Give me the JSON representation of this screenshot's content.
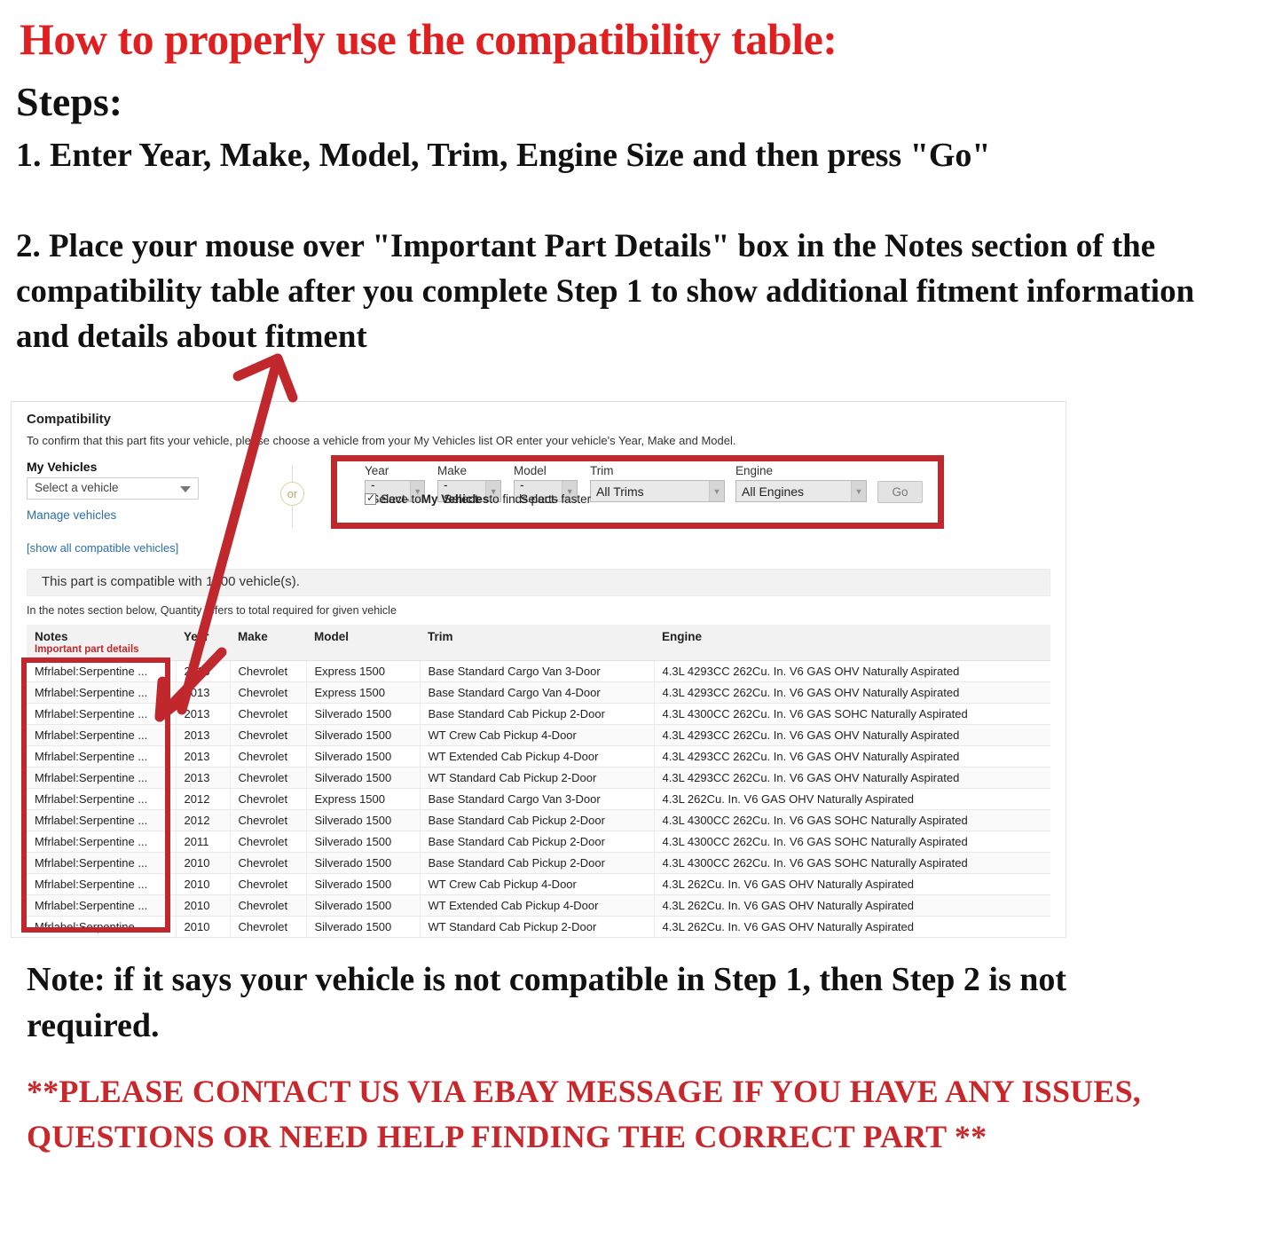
{
  "instructions": {
    "headline": "How to properly use the compatibility table:",
    "steps_label": "Steps:",
    "step1": "1. Enter Year, Make, Model, Trim, Engine Size and then press \"Go\"",
    "step2": "2. Place your mouse over \"Important Part Details\" box in the Notes section of the compatibility table after you complete Step 1 to show additional fitment information and details about fitment",
    "note": "Note: if it says your vehicle is not compatible in Step 1, then Step 2 is not required.",
    "contact": "**PLEASE CONTACT US VIA EBAY MESSAGE IF YOU HAVE ANY ISSUES, QUESTIONS OR NEED HELP FINDING THE CORRECT PART **"
  },
  "colors": {
    "headline_red": "#e02020",
    "annotation_red": "#c0282d",
    "contact_red": "#c8282c",
    "link_blue": "#2b6ea8"
  },
  "panel": {
    "title": "Compatibility",
    "subtitle": "To confirm that this part fits your vehicle, please choose a vehicle from your My Vehicles list OR enter your vehicle's Year, Make and Model.",
    "my_vehicles": {
      "label": "My Vehicles",
      "select_value": "Select a vehicle",
      "manage_link": "Manage vehicles",
      "show_all_link": "[show all compatible vehicles]"
    },
    "or_divider": "or",
    "finder": {
      "fields": [
        {
          "label": "Year",
          "value": "-Select-"
        },
        {
          "label": "Make",
          "value": "-Select-"
        },
        {
          "label": "Model",
          "value": "-Select-"
        },
        {
          "label": "Trim",
          "value": "All Trims"
        },
        {
          "label": "Engine",
          "value": "All Engines"
        }
      ],
      "go_label": "Go",
      "save_prefix": "Save to ",
      "save_bold": "My Vehicles",
      "save_suffix": " to finds parts faster",
      "save_checked": true
    },
    "compat_banner": "This part is compatible with 1000 vehicle(s).",
    "notes_hint": "In the notes section below, Quantity refers to total required for given vehicle",
    "table": {
      "headers": [
        "Notes",
        "Year",
        "Make",
        "Model",
        "Trim",
        "Engine"
      ],
      "notes_sub_header": "Important part details",
      "rows": [
        {
          "notes": "Mfrlabel:Serpentine ...",
          "year": "2013",
          "make": "Chevrolet",
          "model": "Express 1500",
          "trim": "Base Standard Cargo Van 3-Door",
          "engine": "4.3L 4293CC 262Cu. In. V6 GAS OHV Naturally Aspirated"
        },
        {
          "notes": "Mfrlabel:Serpentine ...",
          "year": "2013",
          "make": "Chevrolet",
          "model": "Express 1500",
          "trim": "Base Standard Cargo Van 4-Door",
          "engine": "4.3L 4293CC 262Cu. In. V6 GAS OHV Naturally Aspirated"
        },
        {
          "notes": "Mfrlabel:Serpentine ...",
          "year": "2013",
          "make": "Chevrolet",
          "model": "Silverado 1500",
          "trim": "Base Standard Cab Pickup 2-Door",
          "engine": "4.3L 4300CC 262Cu. In. V6 GAS SOHC Naturally Aspirated"
        },
        {
          "notes": "Mfrlabel:Serpentine ...",
          "year": "2013",
          "make": "Chevrolet",
          "model": "Silverado 1500",
          "trim": "WT Crew Cab Pickup 4-Door",
          "engine": "4.3L 4293CC 262Cu. In. V6 GAS OHV Naturally Aspirated"
        },
        {
          "notes": "Mfrlabel:Serpentine ...",
          "year": "2013",
          "make": "Chevrolet",
          "model": "Silverado 1500",
          "trim": "WT Extended Cab Pickup 4-Door",
          "engine": "4.3L 4293CC 262Cu. In. V6 GAS OHV Naturally Aspirated"
        },
        {
          "notes": "Mfrlabel:Serpentine ...",
          "year": "2013",
          "make": "Chevrolet",
          "model": "Silverado 1500",
          "trim": "WT Standard Cab Pickup 2-Door",
          "engine": "4.3L 4293CC 262Cu. In. V6 GAS OHV Naturally Aspirated"
        },
        {
          "notes": "Mfrlabel:Serpentine ...",
          "year": "2012",
          "make": "Chevrolet",
          "model": "Express 1500",
          "trim": "Base Standard Cargo Van 3-Door",
          "engine": "4.3L 262Cu. In. V6 GAS OHV Naturally Aspirated"
        },
        {
          "notes": "Mfrlabel:Serpentine ...",
          "year": "2012",
          "make": "Chevrolet",
          "model": "Silverado 1500",
          "trim": "Base Standard Cab Pickup 2-Door",
          "engine": "4.3L 4300CC 262Cu. In. V6 GAS SOHC Naturally Aspirated"
        },
        {
          "notes": "Mfrlabel:Serpentine ...",
          "year": "2011",
          "make": "Chevrolet",
          "model": "Silverado 1500",
          "trim": "Base Standard Cab Pickup 2-Door",
          "engine": "4.3L 4300CC 262Cu. In. V6 GAS SOHC Naturally Aspirated"
        },
        {
          "notes": "Mfrlabel:Serpentine ...",
          "year": "2010",
          "make": "Chevrolet",
          "model": "Silverado 1500",
          "trim": "Base Standard Cab Pickup 2-Door",
          "engine": "4.3L 4300CC 262Cu. In. V6 GAS SOHC Naturally Aspirated"
        },
        {
          "notes": "Mfrlabel:Serpentine ...",
          "year": "2010",
          "make": "Chevrolet",
          "model": "Silverado 1500",
          "trim": "WT Crew Cab Pickup 4-Door",
          "engine": "4.3L 262Cu. In. V6 GAS OHV Naturally Aspirated"
        },
        {
          "notes": "Mfrlabel:Serpentine ...",
          "year": "2010",
          "make": "Chevrolet",
          "model": "Silverado 1500",
          "trim": "WT Extended Cab Pickup 4-Door",
          "engine": "4.3L 262Cu. In. V6 GAS OHV Naturally Aspirated"
        },
        {
          "notes": "Mfrlabel:Serpentine ...",
          "year": "2010",
          "make": "Chevrolet",
          "model": "Silverado 1500",
          "trim": "WT Standard Cab Pickup 2-Door",
          "engine": "4.3L 262Cu. In. V6 GAS OHV Naturally Aspirated"
        }
      ]
    }
  }
}
